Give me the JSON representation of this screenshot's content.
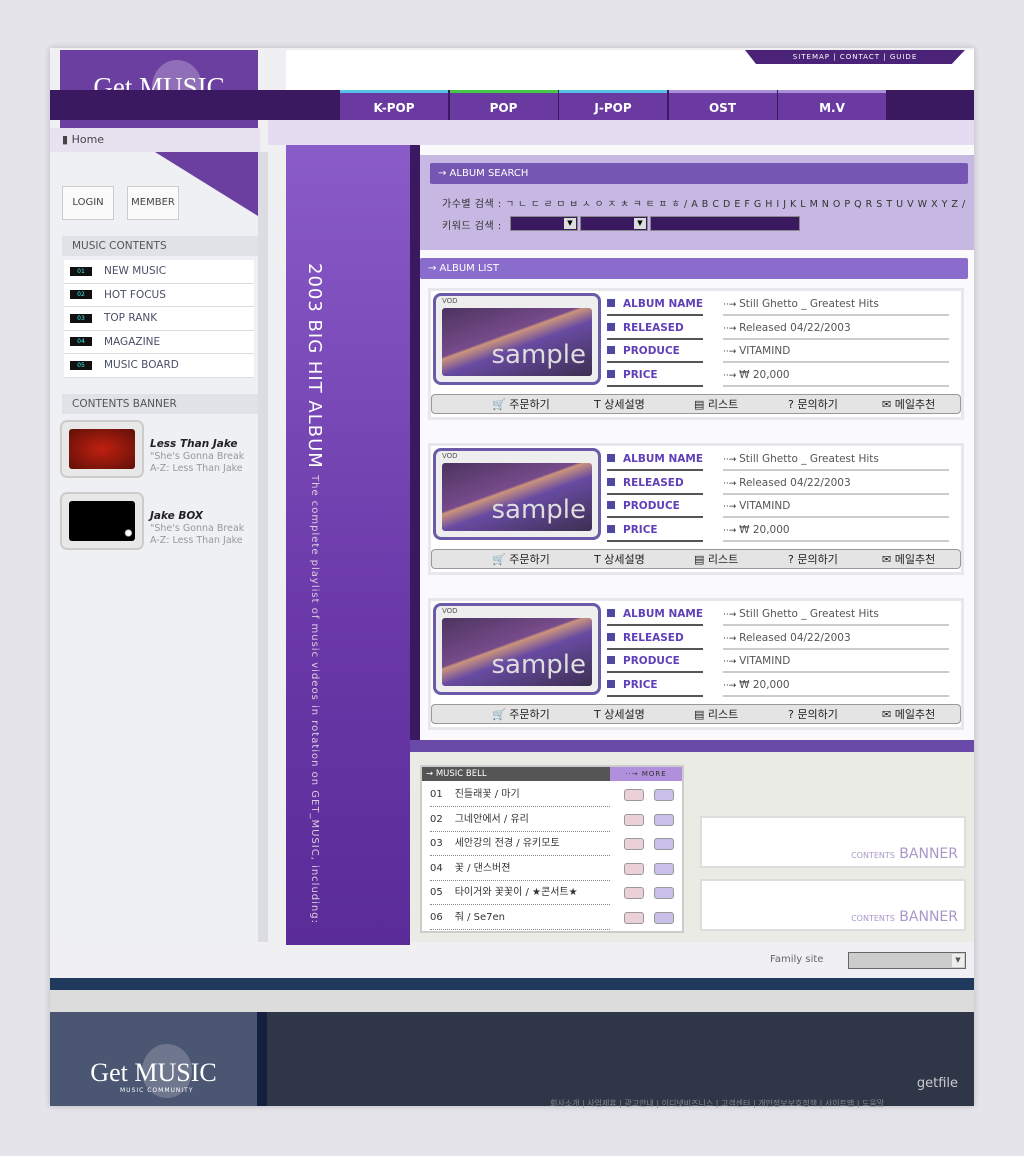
{
  "brand": {
    "title": "Get MUSIC",
    "subtitle": "MUSIC COMMUNITY"
  },
  "top_links": "SITEMAP  |  CONTACT  |  GUIDE",
  "nav": [
    {
      "label": "K-POP",
      "color": "#5bc0e8"
    },
    {
      "label": "POP",
      "color": "#48c848"
    },
    {
      "label": "J-POP",
      "color": "#5bc0e8"
    },
    {
      "label": "OST",
      "color": "#a890d8"
    },
    {
      "label": "M.V",
      "color": "#a890d8"
    }
  ],
  "breadcrumb": "Home",
  "sidebar": {
    "login": "LOGIN",
    "member": "MEMBER",
    "contents_title": "MUSIC CONTENTS",
    "items": [
      {
        "num": "01",
        "label": "NEW MUSIC"
      },
      {
        "num": "02",
        "label": "HOT FOCUS"
      },
      {
        "num": "03",
        "label": "TOP RANK"
      },
      {
        "num": "04",
        "label": "MAGAZINE"
      },
      {
        "num": "05",
        "label": "MUSIC BOARD"
      }
    ],
    "banner_title": "CONTENTS BANNER",
    "banners": [
      {
        "title": "Less Than Jake",
        "line1": "\"She's Gonna Break",
        "line2": "A-Z: Less Than Jake"
      },
      {
        "title": "Jake BOX",
        "line1": "\"She's Gonna Break",
        "line2": "A-Z: Less Than Jake"
      }
    ]
  },
  "band": {
    "title": "2003 BIG HIT ALBUM",
    "subtitle": "The complete playlist of music videos in rotation on GET_MUSIC, including:"
  },
  "search": {
    "title": "→ ALBUM SEARCH",
    "singer_label": "가수별 검색 :",
    "singer_index": "ㄱ ㄴ ㄷ ㄹ ㅁ ㅂ ㅅ ㅇ ㅈ ㅊ ㅋ ㅌ ㅍ ㅎ / A B C D E F G H I J K L M N O P Q R S T U V W X Y Z /",
    "keyword_label": "키워드 검색 :"
  },
  "album_list": {
    "title": "→ ALBUM LIST",
    "thumb_label": "sample",
    "vod": "VOD",
    "field_labels": [
      "ALBUM NAME",
      "RELEASED",
      "PRODUCE",
      "PRICE"
    ],
    "actions": [
      "주문하기",
      "상세설명",
      "리스트",
      "문의하기",
      "메일추천"
    ],
    "albums": [
      {
        "name": "Still Ghetto _ Greatest Hits",
        "released": "Released 04/22/2003",
        "produce": "VITAMIND",
        "price": "₩ 20,000"
      },
      {
        "name": "Still Ghetto _ Greatest Hits",
        "released": "Released 04/22/2003",
        "produce": "VITAMIND",
        "price": "₩ 20,000"
      },
      {
        "name": "Still Ghetto _ Greatest Hits",
        "released": "Released 04/22/2003",
        "produce": "VITAMIND",
        "price": "₩ 20,000"
      }
    ]
  },
  "music_bell": {
    "title": "→ MUSIC BELL",
    "more": "··→  MORE",
    "items": [
      {
        "num": "01",
        "title": "진들래꽃 / 마기"
      },
      {
        "num": "02",
        "title": "그네안에서 / 유리"
      },
      {
        "num": "03",
        "title": "세안강의 전경 / 유키모토"
      },
      {
        "num": "04",
        "title": "꽃 / 댄스버젼"
      },
      {
        "num": "05",
        "title": "타이거와 꽃꽃이 / ★콘서트★"
      },
      {
        "num": "06",
        "title": "줘 / Se7en"
      }
    ]
  },
  "content_banners": [
    {
      "small": "CONTENTS",
      "big": "BANNER"
    },
    {
      "small": "CONTENTS",
      "big": "BANNER"
    }
  ],
  "family_site": {
    "label": "Family site",
    "value": ""
  },
  "footer": {
    "brand": "getfile",
    "links": "회사소개 | 사업제휴 | 광고안내 | 이디넷비즈니스 | 고객센터 | 개인정보보호정책 | 사이트맵 | 도움말"
  }
}
